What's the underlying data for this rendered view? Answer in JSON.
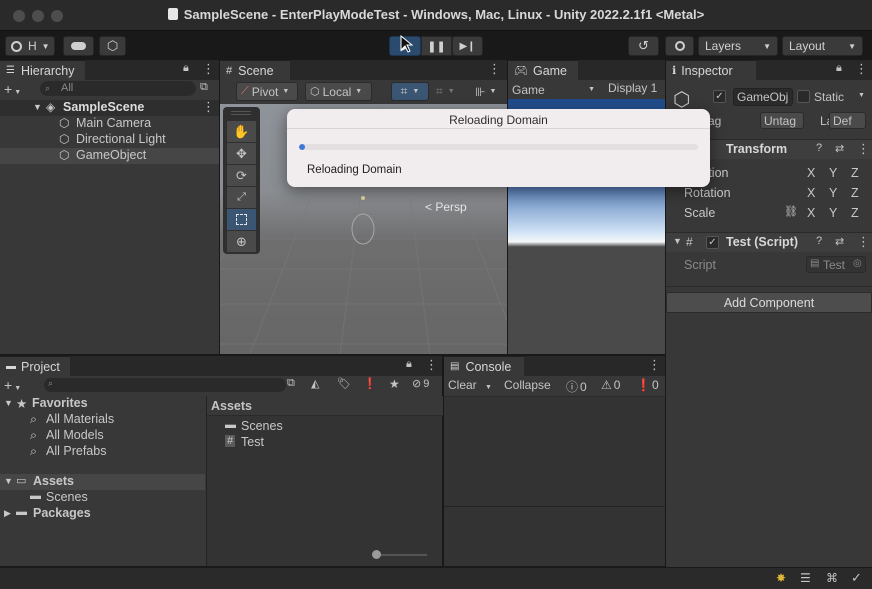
{
  "window": {
    "title": "SampleScene - EnterPlayModeTest - Windows, Mac, Linux - Unity 2022.2.1f1 <Metal>"
  },
  "toolbar": {
    "account_label": "H",
    "layers_label": "Layers",
    "layout_label": "Layout"
  },
  "hierarchy": {
    "tab_label": "Hierarchy",
    "search_placeholder": "All",
    "scene_name": "SampleScene",
    "items": [
      "Main Camera",
      "Directional Light",
      "GameObject"
    ]
  },
  "scene": {
    "tab_label": "Scene",
    "pivot_label": "Pivot",
    "local_label": "Local",
    "persp_label": "Persp"
  },
  "game": {
    "tab_label": "Game",
    "mode_label": "Game",
    "display_label": "Display 1"
  },
  "inspector": {
    "tab_label": "Inspector",
    "object_name": "GameObj",
    "static_label": "Static",
    "tag_label": "Tag",
    "tag_value": "Untag",
    "layer_label": "Layer",
    "layer_value": "Def",
    "transform_label": "Transform",
    "position_label": "Position",
    "rotation_label": "Rotation",
    "scale_label": "Scale",
    "axis_x": "X",
    "axis_y": "Y",
    "axis_z": "Z",
    "script_component_label": "Test (Script)",
    "script_label": "Script",
    "script_value": "Test",
    "add_component_label": "Add Component"
  },
  "project": {
    "tab_label": "Project",
    "hidden_count": "9",
    "favorites_label": "Favorites",
    "favorites": [
      "All Materials",
      "All Models",
      "All Prefabs"
    ],
    "assets_label": "Assets",
    "asset_children": [
      "Scenes"
    ],
    "packages_label": "Packages",
    "breadcrumb": "Assets",
    "files": [
      "Scenes",
      "Test"
    ]
  },
  "console": {
    "tab_label": "Console",
    "clear_label": "Clear",
    "collapse_label": "Collapse",
    "log_count": "0",
    "warn_count": "0",
    "error_count": "0"
  },
  "dialog": {
    "title": "Reloading Domain",
    "message": "Reloading Domain",
    "progress": 0.012
  },
  "colors": {
    "accent": "#3b78d8",
    "play_active": "#2b4b6e",
    "selected_tool": "#3a5673",
    "game_sky_top": "#2f4f7a"
  }
}
